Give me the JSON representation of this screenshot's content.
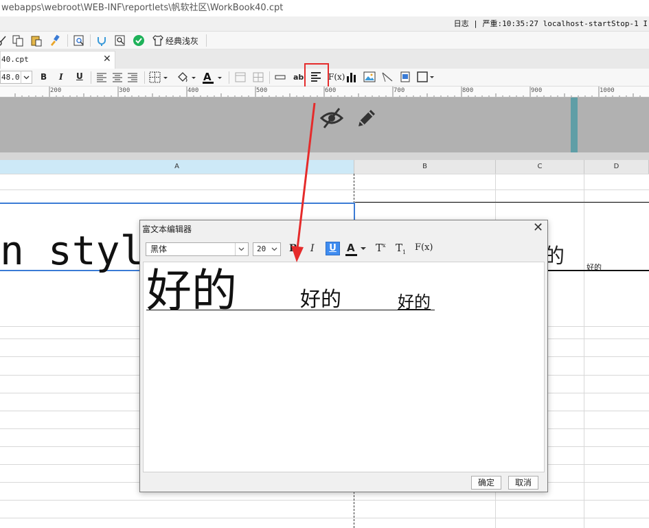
{
  "window": {
    "path": "webapps\\webroot\\WEB-INF\\reportlets\\帆软社区\\WorkBook40.cpt"
  },
  "log": {
    "text": "日志 | 严重:10:35:27 localhost-startStop-1 I"
  },
  "toolbar1": {
    "theme_label": "经典浅灰",
    "icons": [
      "cut-icon",
      "copy-icon",
      "paste-icon",
      "format-brush-icon",
      "preview-icon",
      "plugin-icon",
      "search-preview-icon",
      "check-icon",
      "theme-shirt-icon"
    ]
  },
  "tab": {
    "label": "40.cpt",
    "close": "✕"
  },
  "toolbar2": {
    "font_size": "48.0",
    "bold": "B",
    "italic": "I",
    "underline": "U",
    "text_label": "ab",
    "fx": "F(x)"
  },
  "ruler": {
    "ticks": [
      "200",
      "300",
      "400",
      "500",
      "600",
      "700",
      "800",
      "900",
      "1000"
    ]
  },
  "grid": {
    "columns": [
      "A",
      "B",
      "C",
      "D"
    ],
    "cell_a_text": "n style",
    "cell_c_text": "的",
    "cell_d_text": "好的"
  },
  "dialog": {
    "title": "富文本编辑器",
    "close": "✕",
    "font": "黑体",
    "size": "20",
    "bold": "B",
    "italic": "I",
    "underline": "U",
    "color": "A",
    "superscript": "T",
    "subscript": "T",
    "fx": "F(x)",
    "content": {
      "big": "好的",
      "mid": "好的",
      "small": "好的"
    },
    "ok": "确定",
    "cancel": "取消"
  },
  "colors": {
    "highlight": "#e52b2b",
    "selection": "#3a7bd5",
    "underline_active": "#3f8cf0",
    "teal_marker": "#5f9ea6"
  }
}
